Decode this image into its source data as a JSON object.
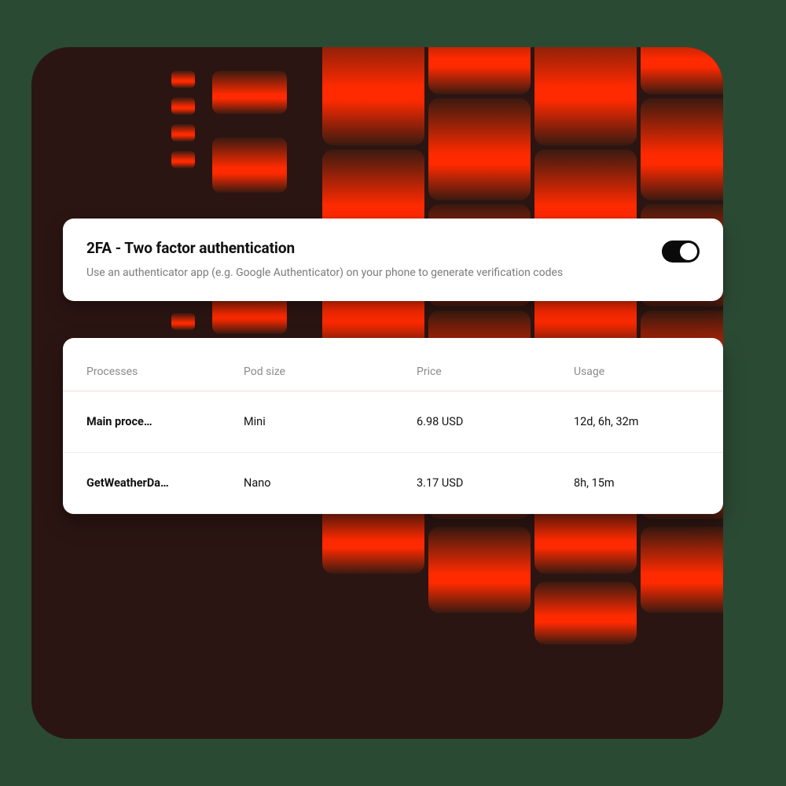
{
  "twofa": {
    "title": "2FA - Two factor authentication",
    "description": "Use an authenticator app (e.g. Google Authenticator) on your phone to generate verification codes",
    "enabled": true
  },
  "table": {
    "headers": {
      "processes": "Processes",
      "pod_size": "Pod size",
      "price": "Price",
      "usage": "Usage"
    },
    "rows": [
      {
        "process": "Main proce…",
        "pod_size": "Mini",
        "price": "6.98 USD",
        "usage": "12d, 6h, 32m"
      },
      {
        "process": "GetWeatherDa…",
        "pod_size": "Nano",
        "price": "3.17 USD",
        "usage": "8h, 15m"
      }
    ]
  }
}
